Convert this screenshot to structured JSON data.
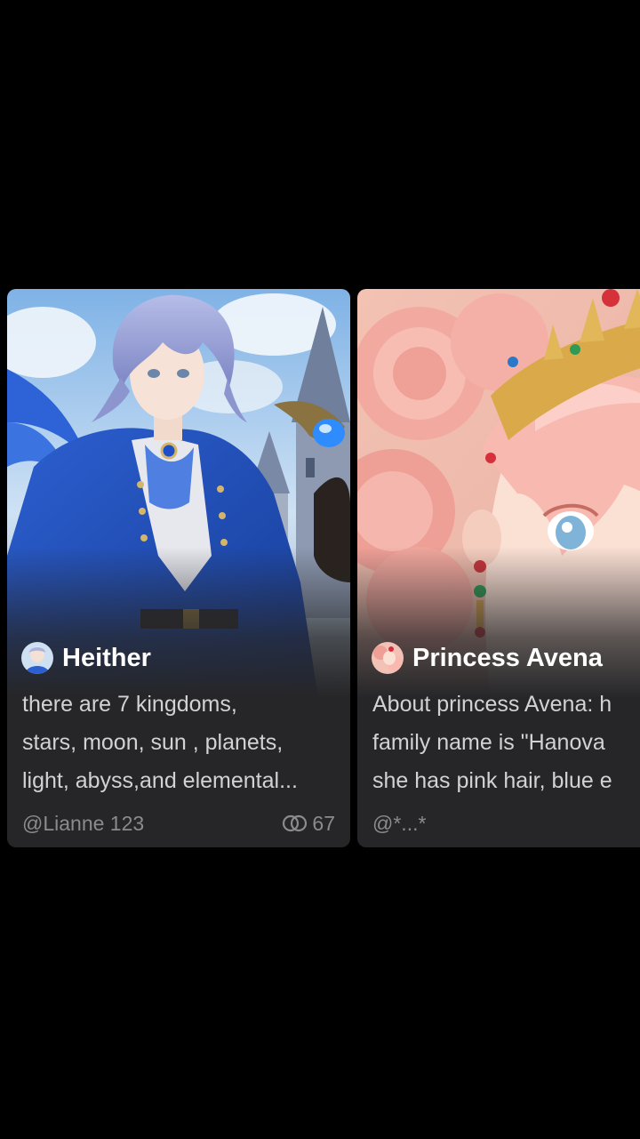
{
  "cards": [
    {
      "name": "Heither",
      "description": [
        "there are 7 kingdoms,",
        "stars, moon, sun , planets,",
        "light, abyss,and elemental..."
      ],
      "author": "@Lianne 123",
      "chat_count": "67",
      "chat_icon": "chat-bubbles-icon"
    },
    {
      "name": "Princess Avena",
      "description": [
        "About princess Avena: h",
        "family name is \"Hanova",
        "she has pink hair, blue e"
      ],
      "author": "@*...*",
      "chat_icon": "chat-bubbles-icon"
    }
  ],
  "colors": {
    "background": "#000000",
    "card": "#262628",
    "title": "#ffffff",
    "description": "#d2d2d2",
    "meta": "#8b8b8d"
  }
}
